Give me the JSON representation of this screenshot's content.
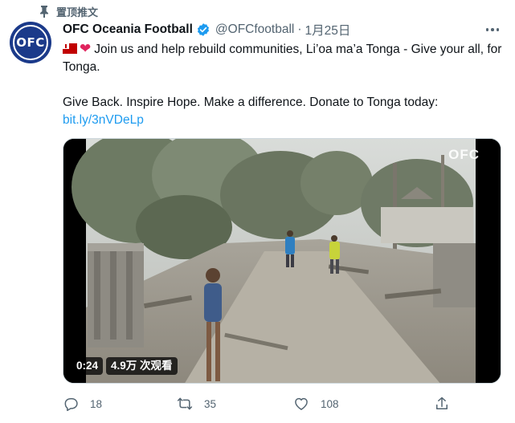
{
  "pinned": {
    "label": "置顶推文"
  },
  "avatar": {
    "text": "OFC"
  },
  "author": {
    "name": "OFC Oceania Football",
    "handle": "@OFCfootball",
    "separator": "·",
    "date": "1月25日"
  },
  "tweet": {
    "line1": "Join us and help rebuild communities, Li’oa ma’a Tonga - Give your all, for Tonga.",
    "line2": "Give Back. Inspire Hope. Make a difference. Donate to Tonga today:",
    "link": "bit.ly/3nVDeLp"
  },
  "media": {
    "watermark": "OFC",
    "time": "0:24",
    "views": "4.9万 次观看"
  },
  "actions": {
    "replies": "18",
    "retweets": "35",
    "likes": "108"
  },
  "colors": {
    "link": "#1d9bf0",
    "verified": "#1d9bf0",
    "muted": "#536471",
    "avatar_bg": "#1b3a8a"
  }
}
